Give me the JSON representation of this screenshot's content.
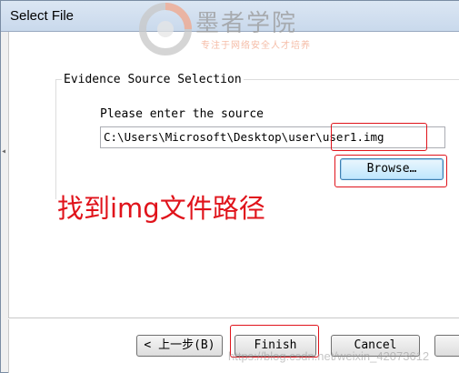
{
  "window": {
    "title": "Select File"
  },
  "logo": {
    "name": "墨者学院",
    "tagline": "专注于网络安全人才培养"
  },
  "group": {
    "label": "Evidence Source Selection",
    "prompt": "Please enter the source",
    "path_value": "C:\\Users\\Microsoft\\Desktop\\user\\user1.img",
    "browse_label": "Browse…"
  },
  "annotation": {
    "text": "找到img文件路径",
    "color": "#e0131b"
  },
  "footer": {
    "back_label": "< 上一步(B)",
    "finish_label": "Finish",
    "cancel_label": "Cancel"
  },
  "watermark": {
    "text": "https://blog.csdn.net/weixin_42073612"
  },
  "icons": {
    "logo": "moze-logo-icon"
  }
}
